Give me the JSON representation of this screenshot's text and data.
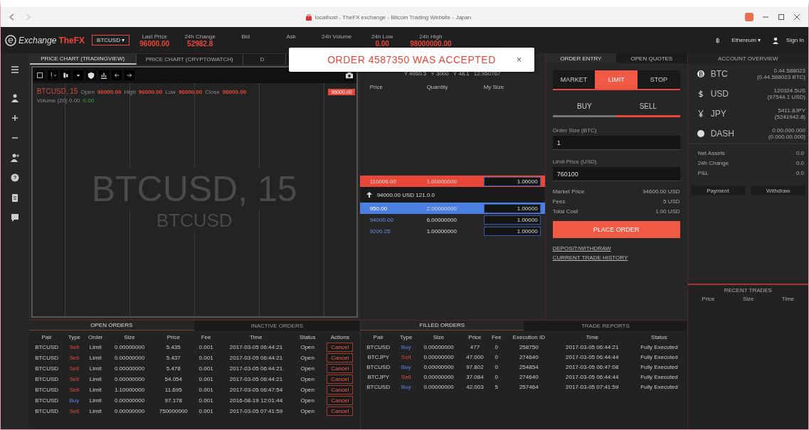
{
  "browser": {
    "title": "localhost - TheFX exchange - Bitcoin Trading Website - Japan"
  },
  "header": {
    "logo": "Exchange",
    "brand": "TheFX",
    "pair": "BTCUSD ▾",
    "stats": [
      {
        "label": "Last Price",
        "value": "96000.00"
      },
      {
        "label": "24h Change",
        "value": "52982.8"
      },
      {
        "label": "Bid"
      },
      {
        "label": "Ask"
      },
      {
        "label": "24h Volume"
      },
      {
        "label": "24h Low",
        "value": "0.00"
      },
      {
        "label": "24h High",
        "value": "98000000.00"
      }
    ],
    "currency": "฿",
    "account": "Ethereum ▾",
    "user": "Sign In"
  },
  "toast": {
    "message": "ORDER 4587350 WAS ACCEPTED",
    "close": "×"
  },
  "chart_tabs": [
    {
      "label": "PRICE CHART (TRADINGVIEW)",
      "selected": true
    },
    {
      "label": "PRICE CHART (CRYPTOWATCH)",
      "selected": false
    },
    {
      "label": "D",
      "selected": false
    }
  ],
  "chart": {
    "symbol": "BTCUSD, 15",
    "ohlc": [
      {
        "label": "Open",
        "value": "96000.00"
      },
      {
        "label": "High",
        "value": "96000.00"
      },
      {
        "label": "Low",
        "value": "96000.00"
      },
      {
        "label": "Close",
        "value": "96000.00"
      }
    ],
    "volume_label": "Volume (20) 0.00",
    "volume_value": "0.00",
    "watermark": "BTCUSD, 15",
    "watermark_sub": "BTCUSD",
    "price_tag": "96000.00"
  },
  "order_book": {
    "summary": [
      "Y 4060.5",
      "Y 3000",
      "Y 48.1",
      "12.950767"
    ],
    "columns": [
      "Price",
      "Quantity",
      "My Size"
    ],
    "asks": [
      {
        "price": "110006.00",
        "quantity": "1.00000000",
        "my_size": "1.00000",
        "highlighted": true
      }
    ],
    "mid": "94000.00 USD  121.0.0",
    "bids": [
      {
        "price": "950.00",
        "quantity": "2.00000000",
        "my_size": "1.00000",
        "highlighted": true
      },
      {
        "price": "94000.00",
        "quantity": "6.00000000",
        "my_size": "1.00000",
        "highlighted": false
      },
      {
        "price": "9200.25",
        "quantity": "1.00000000",
        "my_size": "1.00000",
        "highlighted": false
      }
    ]
  },
  "order_entry": {
    "tabs": [
      {
        "label": "ORDER ENTRY",
        "selected": true
      },
      {
        "label": "OPEN QUOTES",
        "selected": false
      }
    ],
    "order_types": [
      {
        "label": "MARKET",
        "selected": false
      },
      {
        "label": "LIMIT",
        "selected": true
      },
      {
        "label": "STOP",
        "selected": false
      }
    ],
    "sides": [
      {
        "label": "BUY",
        "selected": false
      },
      {
        "label": "SELL",
        "selected": true
      }
    ],
    "fields": [
      {
        "label": "Order Size (BTC)",
        "value": "1"
      },
      {
        "label": "Limit Price (USD)",
        "value": "760100"
      }
    ],
    "summary": [
      {
        "label": "Market Price",
        "value": "94600.00 USD"
      },
      {
        "label": "Fees",
        "value": "5 USD"
      },
      {
        "label": "Total Cost",
        "value": "1.00 USD"
      }
    ],
    "submit": "PLACE ORDER",
    "links": [
      "DEPOSIT/WITHDRAW",
      "CURRENT TRADE HISTORY"
    ]
  },
  "account": {
    "title": "ACCOUNT OVERVIEW",
    "balances": [
      {
        "currency": "BTC",
        "amount": "0.44.588023",
        "converted": "(0.44.588023 BTC)"
      },
      {
        "currency": "USD",
        "amount": "120324.5US",
        "converted": "(97544.1 USD)"
      },
      {
        "currency": "JPY",
        "amount": "5411.8JPY",
        "converted": "(5241942.8)"
      },
      {
        "currency": "DASH",
        "amount": "0.00.000.000",
        "converted": "(0.000.00.000)"
      }
    ],
    "stats": [
      {
        "label": "Net Assets",
        "value": "0.0"
      },
      {
        "label": "24h Change",
        "value": "0.0"
      },
      {
        "label": "P&L",
        "value": "0.0"
      }
    ],
    "buttons": [
      "Payment",
      "Withdraw"
    ]
  },
  "recent_trades": {
    "title": "RECENT TRADES",
    "columns": [
      "Price",
      "Size",
      "Time"
    ]
  },
  "open_orders": {
    "tabs": [
      {
        "label": "OPEN ORDERS",
        "selected": true
      },
      {
        "label": "INACTIVE ORDERS",
        "selected": false
      }
    ],
    "columns": [
      "Pair",
      "Type",
      "Order",
      "Size",
      "Price",
      "Fee",
      "Time",
      "Status",
      "Actions"
    ],
    "rows": [
      {
        "cells": [
          "BTCUSD",
          "Sell",
          "Limit",
          "0.00000000",
          "5.435",
          "0.001",
          "2017-03-05 06:44:21",
          "Open"
        ],
        "kind": "sell",
        "action": "Cancel"
      },
      {
        "cells": [
          "BTCUSD",
          "Sell",
          "Limit",
          "0.00000000",
          "5.437",
          "0.001",
          "2017-03-05 06:44:21",
          "Open"
        ],
        "kind": "sell",
        "action": "Cancel"
      },
      {
        "cells": [
          "BTCUSD",
          "Sell",
          "Limit",
          "0.00000000",
          "5.478",
          "0.001",
          "2017-03-05 06:44:21",
          "Open"
        ],
        "kind": "sell",
        "action": "Cancel"
      },
      {
        "cells": [
          "BTCUSD",
          "Sell",
          "Limit",
          "0.00000000",
          "54.054",
          "0.001",
          "2017-03-05 06:44:21",
          "Open"
        ],
        "kind": "sell",
        "action": "Cancel"
      },
      {
        "cells": [
          "BTCUSD",
          "Sell",
          "Limit",
          "1.10000000",
          "11.695",
          "0.001",
          "2017-03-05 06:47:54",
          "Open"
        ],
        "kind": "sell",
        "action": "Cancel"
      },
      {
        "cells": [
          "BTCUSD",
          "Buy",
          "Limit",
          "0.00000000",
          "97.178",
          "0.001",
          "2016-08-19 12:01:44",
          "Open"
        ],
        "kind": "buy",
        "action": "Cancel"
      },
      {
        "cells": [
          "BTCUSD",
          "Sell",
          "Limit",
          "0.00000000",
          "750000000",
          "0.001",
          "2017-03-05 07:41:59",
          "Open"
        ],
        "kind": "sell",
        "action": "Cancel"
      }
    ]
  },
  "filled_orders": {
    "tabs": [
      {
        "label": "FILLED ORDERS",
        "selected": true
      },
      {
        "label": "TRADE REPORTS",
        "selected": false
      }
    ],
    "columns": [
      "Pair",
      "Type",
      "Size",
      "Price",
      "Fee",
      "Execution ID",
      "Time",
      "Status"
    ],
    "rows": [
      {
        "cells": [
          "BTCUSD",
          "Buy",
          "0.00000000",
          "477",
          "0",
          "258750",
          "2017-03-05 06:44:21",
          "Fully Executed"
        ],
        "kind": "buy"
      },
      {
        "cells": [
          "BTCJPY",
          "Sell",
          "0.00000000",
          "47.000",
          "0",
          "274640",
          "2017-03-05 06:44:44",
          "Fully Executed"
        ],
        "kind": "sell"
      },
      {
        "cells": [
          "BTCUSD",
          "Buy",
          "0.00000000",
          "97.802",
          "0",
          "254854",
          "2017-03-05 06:47:08",
          "Fully Executed"
        ],
        "kind": "buy"
      },
      {
        "cells": [
          "BTCJPY",
          "Sell",
          "0.00000000",
          "37.084",
          "0",
          "274640",
          "2017-03-05 06:44:44",
          "Fully Executed"
        ],
        "kind": "sell"
      },
      {
        "cells": [
          "BTCUSD",
          "Buy",
          "0.00000000",
          "42.003",
          "5",
          "257464",
          "2017-03-05 07:41:59",
          "Fully Executed"
        ],
        "kind": "buy"
      }
    ]
  }
}
